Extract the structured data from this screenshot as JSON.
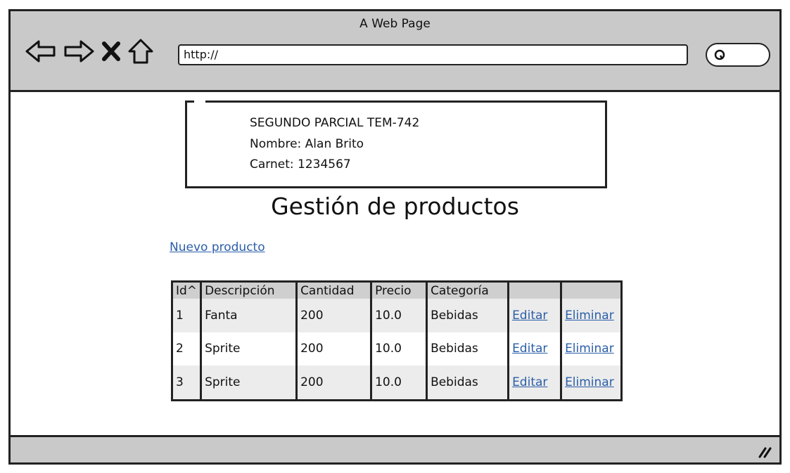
{
  "browser": {
    "title": "A Web Page",
    "url": "http://"
  },
  "info": {
    "line1": "SEGUNDO PARCIAL TEM-742",
    "line2": "Nombre: Alan Brito",
    "line3": "Carnet: 1234567"
  },
  "page": {
    "heading": "Gestión de productos",
    "new_link": "Nuevo producto"
  },
  "table": {
    "headers": [
      "Id^",
      "Descripción",
      "Cantidad",
      "Precio",
      "Categoría",
      "",
      ""
    ],
    "rows": [
      [
        "1",
        "Fanta",
        "200",
        "10.0",
        "Bebidas",
        "Editar",
        "Eliminar"
      ],
      [
        "2",
        "Sprite",
        "200",
        "10.0",
        "Bebidas",
        "Editar",
        "Eliminar"
      ],
      [
        "3",
        "Sprite",
        "200",
        "10.0",
        "Bebidas",
        "Editar",
        "Eliminar"
      ]
    ]
  },
  "colors": {
    "chrome": "#c9c9c9",
    "link": "#2a5ea8",
    "header_row": "#cfcfcf",
    "shaded_row": "#ececec"
  }
}
